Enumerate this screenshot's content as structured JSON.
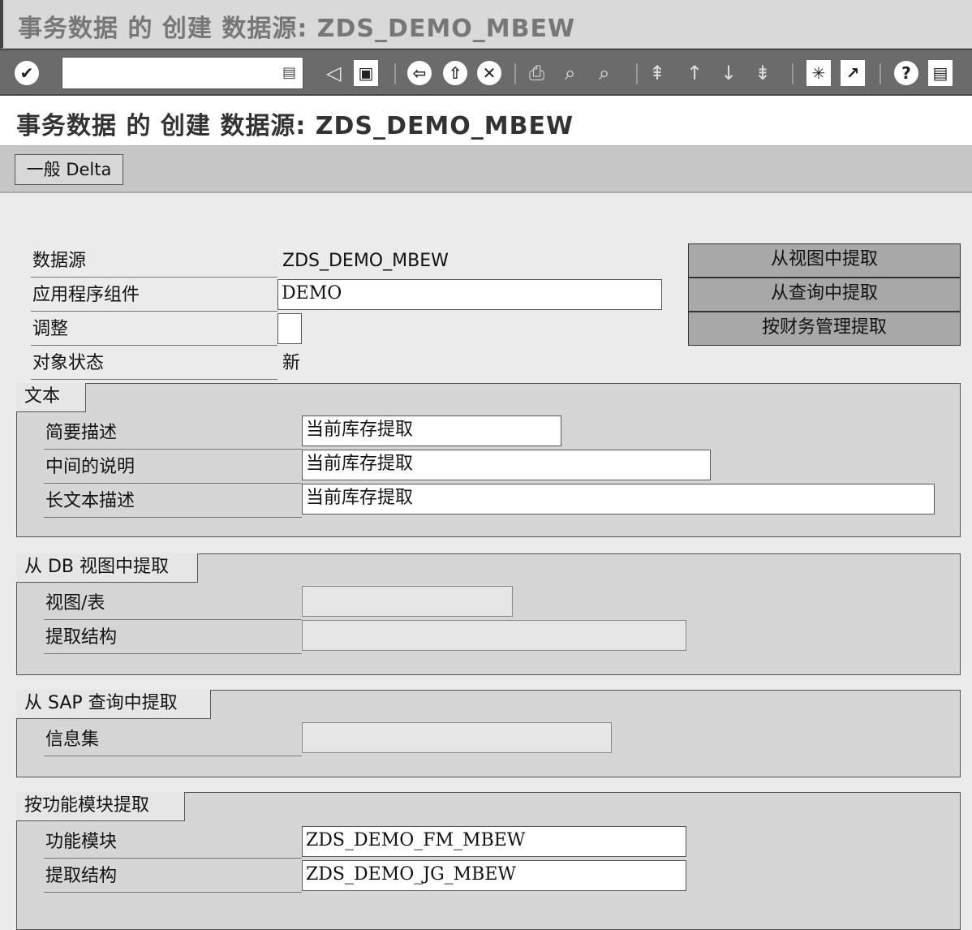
{
  "window": {
    "title": "事务数据 的 创建 数据源: ZDS_DEMO_MBEW"
  },
  "toolbar": {
    "command_value": "",
    "dropdown_glyph": "▤"
  },
  "page": {
    "title": "事务数据 的 创建 数据源: ZDS_DEMO_MBEW"
  },
  "app_toolbar": {
    "tab_label": "一般 Delta"
  },
  "header": {
    "datasource_label": "数据源",
    "datasource_value": "ZDS_DEMO_MBEW",
    "app_component_label": "应用程序组件",
    "app_component_value": "DEMO",
    "adjust_label": "调整",
    "adjust_value": "",
    "object_status_label": "对象状态",
    "object_status_value": "新"
  },
  "side_buttons": {
    "from_view": "从视图中提取",
    "from_query": "从查询中提取",
    "from_finance": "按财务管理提取"
  },
  "text_group": {
    "title": "文本",
    "short_label": "简要描述",
    "short_value": "当前库存提取",
    "medium_label": "中间的说明",
    "medium_value": "当前库存提取",
    "long_label": "长文本描述",
    "long_value": "当前库存提取"
  },
  "db_view_group": {
    "title": "从 DB 视图中提取",
    "view_label": "视图/表",
    "view_value": "",
    "structure_label": "提取结构",
    "structure_value": ""
  },
  "query_group": {
    "title": "从 SAP 查询中提取",
    "infoset_label": "信息集",
    "infoset_value": ""
  },
  "fm_group": {
    "title": "按功能模块提取",
    "fm_label": "功能模块",
    "fm_value": "ZDS_DEMO_FM_MBEW",
    "structure_label": "提取结构",
    "structure_value": "ZDS_DEMO_JG_MBEW"
  }
}
